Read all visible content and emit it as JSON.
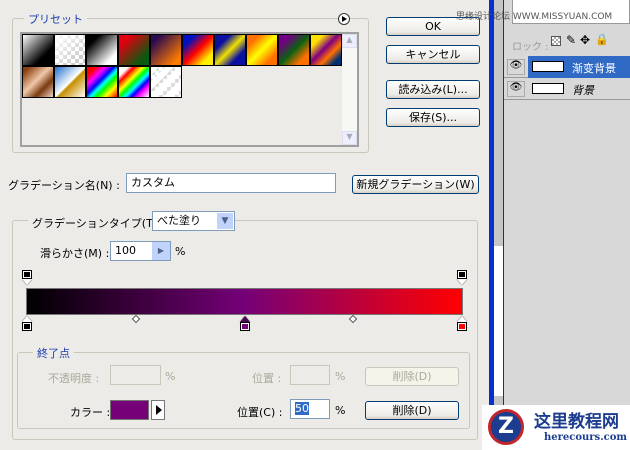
{
  "watermark_top": "思缘设计论坛 WWW.MISSYUAN.COM",
  "presets": {
    "label": "プリセット",
    "menu_icon": "arrow-circle-icon",
    "swatches": [
      "linear-gradient(135deg,#fff,#000 70%)",
      "linear-gradient(135deg,#fff,rgba(255,255,255,0) 80%),repeating-conic-gradient(#ccc 0 25%,#fff 0 50%) 0 0/8px 8px",
      "linear-gradient(135deg,#000 20%,#fff 80%)",
      "linear-gradient(135deg,#e00010 20%,#0a5a10 80%)",
      "linear-gradient(135deg,#2a0a50 15%,#ff7a00 85%)",
      "linear-gradient(135deg,#0010c0 20%,#ff0000 50%,#ffee00 80%)",
      "linear-gradient(135deg,#0a10a0 25%,#f0e000 50%,#0a10a0 75%)",
      "linear-gradient(135deg,#ff7000 20%,#ffff00 50%,#ff7000 80%)",
      "linear-gradient(135deg,#700080 20%,#0a6010 50%,#ff7000 80%)",
      "linear-gradient(135deg,#ffe000 20%,#800080 45%,#ff7000 65%,#003070 85%)",
      "linear-gradient(135deg,#8a4010 10%,#f0c8a8 45%,#7a3a10 70%,#f0d8c8)",
      "linear-gradient(135deg,#2070d0,#fff 50%,#c89000 55%,#fff)",
      "linear-gradient(135deg,#f00 15%,#f0f 30%,#00f 45%,#0ff 55%,#0f0 65%,#ff0 80%,#f00)",
      "linear-gradient(135deg,#fff 15%,#f00 25%,#ff0 40%,#0f0 50%,#0ff 60%,#00f 70%,#f0f 80%,#fff),#fff",
      "repeating-linear-gradient(135deg,#fff 0 6px,rgba(255,255,255,.3) 6px 10px),repeating-conic-gradient(#ccc 0 25%,#fff 0 50%) 0 0/8px 8px"
    ]
  },
  "buttons": {
    "ok": "OK",
    "cancel": "キャンセル",
    "load": "読み込み(L)...",
    "save": "保存(S)...",
    "new_gradient": "新規グラデーション(W)"
  },
  "name": {
    "label": "グラデーション名(N) :",
    "value": "カスタム"
  },
  "type": {
    "label": "グラデーションタイプ(T) :",
    "value": "べた塗り"
  },
  "smoothness": {
    "label": "滑らかさ(M) :",
    "value": "100",
    "unit": "%"
  },
  "gradient": {
    "colors": [
      "#000000",
      "#750078",
      "#ff0000"
    ],
    "color_stops_percent": [
      0,
      50,
      100
    ],
    "midpoints_percent": [
      25,
      75
    ],
    "opacity_stops_percent": [
      0,
      100
    ]
  },
  "endpoint": {
    "label": "終了点",
    "opacity_label": "不透明度 :",
    "opacity_value": "",
    "opacity_unit": "%",
    "opacity_pos_label": "位置 :",
    "opacity_pos_value": "",
    "opacity_pos_unit": "%",
    "delete1": "削除(D)",
    "color_label": "カラー :",
    "color_value": "#750078",
    "color_pos_label": "位置(C) :",
    "color_pos_value": "50",
    "color_pos_unit": "%",
    "delete2": "削除(D)"
  },
  "layers": {
    "lock_label": "ロック :",
    "items": [
      {
        "name": "渐变背景",
        "selected": true
      },
      {
        "name": "背景",
        "selected": false
      }
    ]
  },
  "logo": {
    "title": "这里教程网",
    "url": "herecours.com"
  }
}
